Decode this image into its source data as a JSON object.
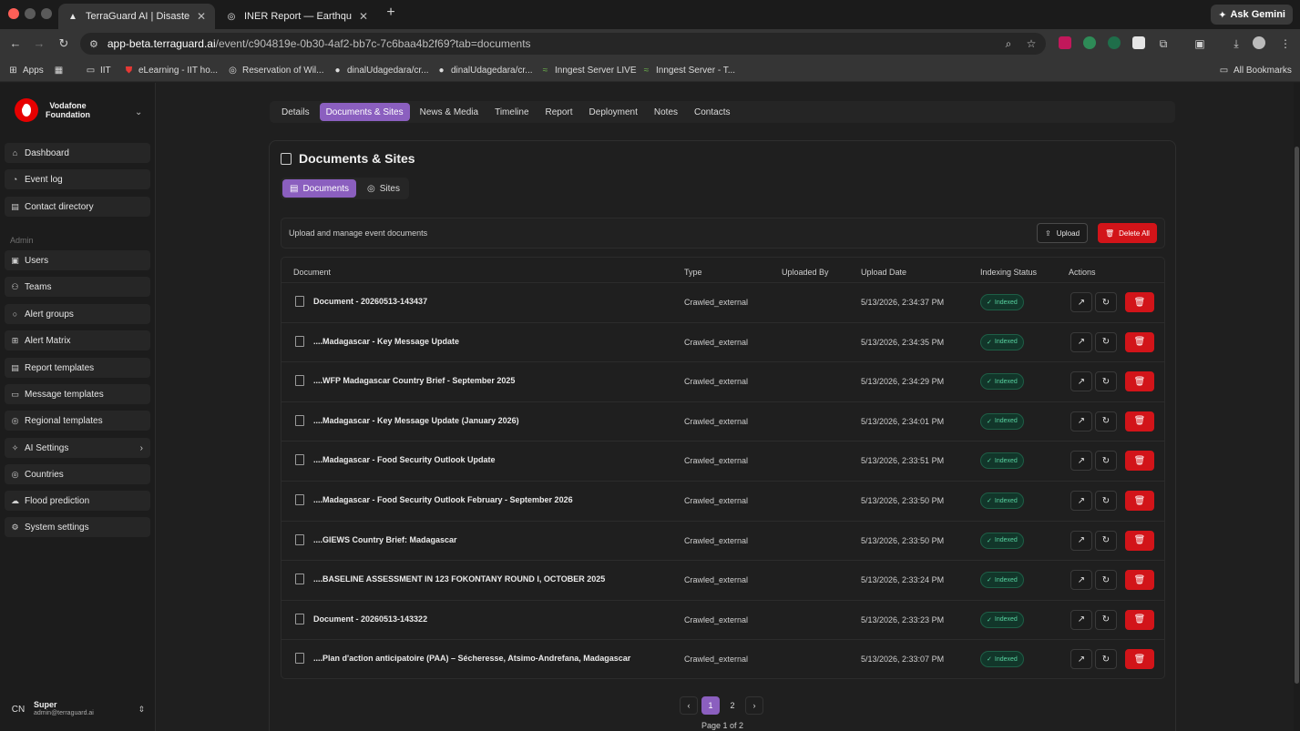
{
  "browser": {
    "tabs": [
      {
        "title": "TerraGuard AI | Disaster Risk",
        "active": true
      },
      {
        "title": "INER Report — Earthquake in",
        "active": false
      }
    ],
    "ask_gemini": "Ask Gemini",
    "url_host": "app-beta.terraguard.ai",
    "url_path": "/event/c904819e-0b30-4af2-bb7c-7c6baa4b2f69?tab=documents",
    "bookmarks": [
      "Apps",
      "IIT",
      "eLearning - IIT ho...",
      "Reservation of Wil...",
      "dinalUdagedara/cr...",
      "dinalUdagedara/cr...",
      "Inngest Server LIVE",
      "Inngest Server - T..."
    ],
    "all_bookmarks": "All Bookmarks"
  },
  "sidebar": {
    "org_line1": "Vodafone",
    "org_line2": "Foundation",
    "items": [
      "Dashboard",
      "Event log",
      "Contact directory"
    ],
    "admin_label": "Admin",
    "admin_items": [
      "Users",
      "Teams",
      "Alert groups",
      "Alert Matrix",
      "Report templates",
      "Message templates",
      "Regional templates",
      "AI Settings",
      "Countries",
      "Flood prediction",
      "System settings"
    ],
    "user": {
      "initials": "CN",
      "name": "Super",
      "email": "admin@terraguard.ai"
    }
  },
  "event_tabs": [
    "Details",
    "Documents & Sites",
    "News & Media",
    "Timeline",
    "Report",
    "Deployment",
    "Notes",
    "Contacts"
  ],
  "card": {
    "title": "Documents & Sites",
    "seg_documents": "Documents",
    "seg_sites": "Sites",
    "description": "Upload and manage event documents",
    "upload_label": "Upload",
    "delete_all_label": "Delete All"
  },
  "table": {
    "headers": [
      "Document",
      "Type",
      "Uploaded By",
      "Upload Date",
      "Indexing Status",
      "Actions"
    ],
    "rows": [
      {
        "doc": "Document - 20260513-143437",
        "type": "Crawled_external",
        "date": "5/13/2026, 2:34:37 PM",
        "status": "Indexed"
      },
      {
        "doc": "....Madagascar - Key Message Update",
        "type": "Crawled_external",
        "date": "5/13/2026, 2:34:35 PM",
        "status": "Indexed"
      },
      {
        "doc": "....WFP Madagascar Country Brief - September 2025",
        "type": "Crawled_external",
        "date": "5/13/2026, 2:34:29 PM",
        "status": "Indexed"
      },
      {
        "doc": "....Madagascar - Key Message Update (January 2026)",
        "type": "Crawled_external",
        "date": "5/13/2026, 2:34:01 PM",
        "status": "Indexed"
      },
      {
        "doc": "....Madagascar - Food Security Outlook Update",
        "type": "Crawled_external",
        "date": "5/13/2026, 2:33:51 PM",
        "status": "Indexed"
      },
      {
        "doc": "....Madagascar - Food Security Outlook February - September 2026",
        "type": "Crawled_external",
        "date": "5/13/2026, 2:33:50 PM",
        "status": "Indexed"
      },
      {
        "doc": "....GIEWS Country Brief: Madagascar",
        "type": "Crawled_external",
        "date": "5/13/2026, 2:33:50 PM",
        "status": "Indexed"
      },
      {
        "doc": "....BASELINE ASSESSMENT IN 123 FOKONTANY ROUND I, OCTOBER 2025",
        "type": "Crawled_external",
        "date": "5/13/2026, 2:33:24 PM",
        "status": "Indexed"
      },
      {
        "doc": "Document - 20260513-143322",
        "type": "Crawled_external",
        "date": "5/13/2026, 2:33:23 PM",
        "status": "Indexed"
      },
      {
        "doc": "....Plan d'action anticipatoire (PAA) – Sécheresse, Atsimo-Andrefana, Madagascar",
        "type": "Crawled_external",
        "date": "5/13/2026, 2:33:07 PM",
        "status": "Indexed"
      }
    ]
  },
  "pagination": {
    "pages": [
      "1",
      "2"
    ],
    "current": "1",
    "info": "Page 1 of 2"
  },
  "colors": {
    "accent": "#8b5fbf",
    "danger": "#d21419",
    "indexed": "#57d3a0"
  }
}
